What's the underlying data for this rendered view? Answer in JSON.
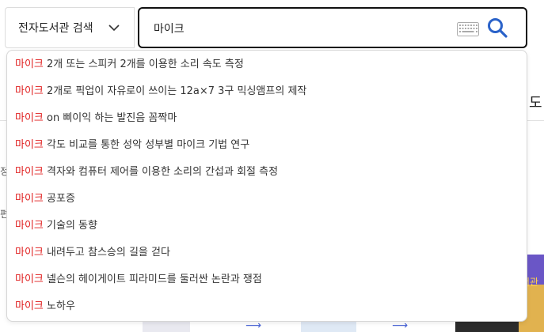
{
  "search": {
    "scope_label": "전자도서관 검색",
    "query": "마이크",
    "placeholder": ""
  },
  "suggestions": [
    {
      "highlight": "마이크",
      "rest": " 2개 또는 스피커 2개를 이용한 소리 속도 측정"
    },
    {
      "highlight": "마이크",
      "rest": " 2개로 픽업이 자유로이 쓰이는 12a×7 3구 믹싱앰프의 제작"
    },
    {
      "highlight": "마이크",
      "rest": " on 삐이익 하는 발진음 꼼짝마"
    },
    {
      "highlight": "마이크",
      "rest": " 각도 비교를 통한 성악 성부별 마이크 기법 연구"
    },
    {
      "highlight": "마이크",
      "rest": " 격자와 컴퓨터 제어를 이용한 소리의 간섭과 회절 측정"
    },
    {
      "highlight": "마이크",
      "rest": " 공포증"
    },
    {
      "highlight": "마이크",
      "rest": " 기술의 동향"
    },
    {
      "highlight": "마이크",
      "rest": " 내려두고 참스승의 길을 걷다"
    },
    {
      "highlight": "마이크",
      "rest": " 넬슨의 헤이게이트 피라미드를 둘러싼 논란과 쟁점"
    },
    {
      "highlight": "마이크",
      "rest": " 노하우"
    }
  ],
  "background": {
    "right_heading": "도",
    "left_glyph_1": "정",
    "left_glyph_2": "편",
    "purple_text": "서관"
  },
  "colors": {
    "highlight": "#e02020",
    "search_icon": "#2a62c9",
    "purple_banner": "#6a56c6"
  },
  "icons": {
    "scope": "chevron-down-icon",
    "keyboard": "keyboard-icon",
    "search": "search-icon"
  }
}
